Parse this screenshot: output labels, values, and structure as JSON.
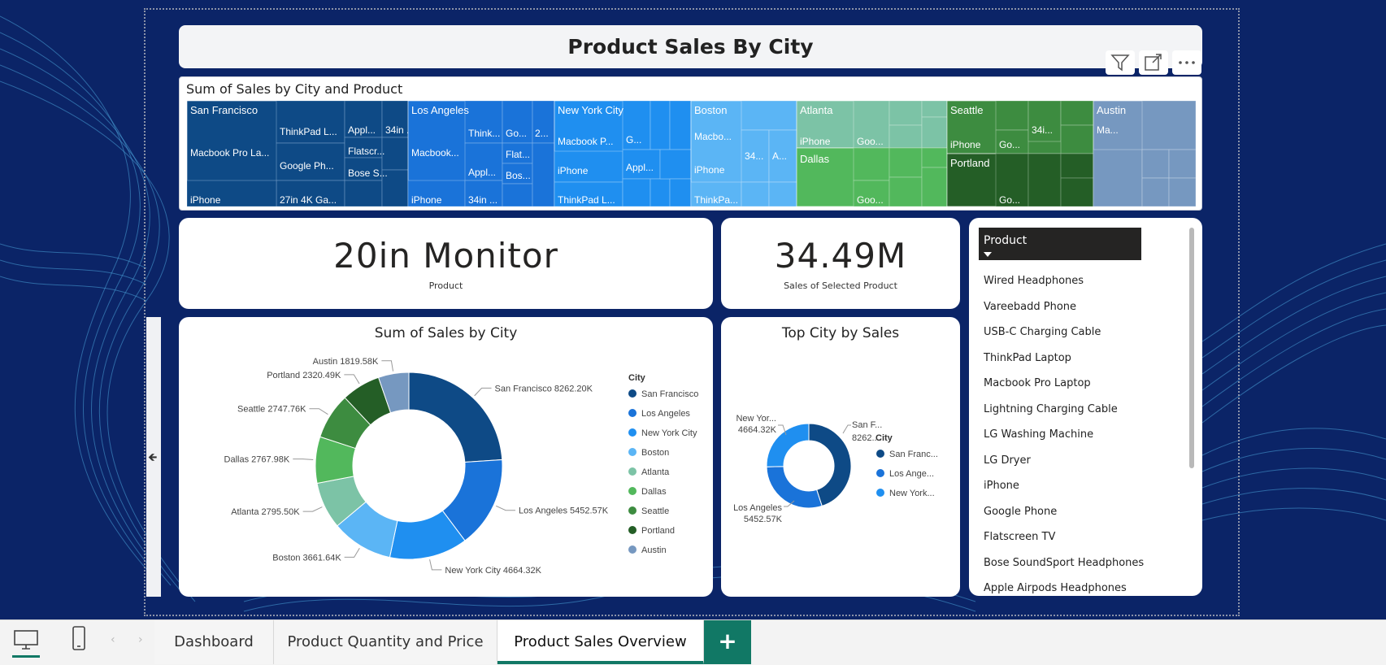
{
  "header": {
    "title": "Product Sales By City"
  },
  "visual_actions": [
    "filter-icon",
    "focus-mode-icon",
    "more-options-icon"
  ],
  "treemap": {
    "title": "Sum of Sales by City and Product",
    "cities": [
      {
        "name": "San Francisco",
        "color": "#0e4a86",
        "labels": [
          "ThinkPad L...",
          "Appl...",
          "34in ...",
          "Macbook Pro La...",
          "Google Ph...",
          "Flatscr...",
          "Bose S...",
          "iPhone",
          "27in 4K Ga..."
        ]
      },
      {
        "name": "Los Angeles",
        "color": "#1a73d9",
        "labels": [
          "Think...",
          "Go...",
          "2...",
          "Macbook...",
          "Flat...",
          "Appl...",
          "Bos...",
          "iPhone",
          "34in ..."
        ]
      },
      {
        "name": "New York City",
        "color": "#1f8ff0",
        "labels": [
          "Macbook P...",
          "G...",
          "iPhone",
          "Appl...",
          "ThinkPad L..."
        ]
      },
      {
        "name": "Boston",
        "color": "#5bb5f5",
        "labels": [
          "Macbo...",
          "iPhone",
          "34...",
          "A...",
          "ThinkPa..."
        ]
      },
      {
        "name": "Atlanta",
        "color": "#7cc3a6",
        "labels": [
          "iPhone",
          "Goo..."
        ]
      },
      {
        "name": "Dallas",
        "color": "#52b85c",
        "labels": [
          "Goo..."
        ]
      },
      {
        "name": "Seattle",
        "color": "#3d8c40",
        "labels": [
          "iPhone",
          "Go...",
          "34i..."
        ]
      },
      {
        "name": "Portland",
        "color": "#245e26",
        "labels": [
          "Go..."
        ]
      },
      {
        "name": "Austin",
        "color": "#7698c0",
        "labels": [
          "Ma..."
        ]
      }
    ]
  },
  "kpi_product": {
    "value": "20in Monitor",
    "label": "Product"
  },
  "kpi_sales": {
    "value": "34.49M",
    "label": "Sales of Selected Product"
  },
  "donut1": {
    "title": "Sum of Sales by City",
    "legend_title": "City"
  },
  "donut2": {
    "title": "Top City by Sales",
    "legend_title": "City",
    "legend": [
      "San Franc...",
      "Los Ange...",
      "New York..."
    ],
    "labels": [
      "San F...",
      "8262....",
      "New Yor...",
      "4664.32K",
      "Los Angeles",
      "5452.57K"
    ]
  },
  "chart_data": [
    {
      "type": "pie",
      "title": "Sum of Sales by City",
      "legend_title": "City",
      "categories": [
        "San Francisco",
        "Los Angeles",
        "New York City",
        "Boston",
        "Atlanta",
        "Dallas",
        "Seattle",
        "Portland",
        "Austin"
      ],
      "values": [
        8262.2,
        5452.57,
        4664.32,
        3661.64,
        2795.5,
        2767.98,
        2747.76,
        2320.49,
        1819.58
      ],
      "data_labels": [
        "San Francisco 8262.20K",
        "Los Angeles 5452.57K",
        "New York City 4664.32K",
        "Boston 3661.64K",
        "Atlanta 2795.50K",
        "Dallas 2767.98K",
        "Seattle 2747.76K",
        "Portland 2320.49K",
        "Austin 1819.58K"
      ],
      "colors": [
        "#0e4a86",
        "#1a73d9",
        "#1f8ff0",
        "#5bb5f5",
        "#7cc3a6",
        "#52b85c",
        "#3d8c40",
        "#245e26",
        "#7698c0"
      ],
      "legend_position": "right"
    },
    {
      "type": "pie",
      "title": "Top City by Sales",
      "legend_title": "City",
      "categories": [
        "San Francisco",
        "Los Angeles",
        "New York City"
      ],
      "values": [
        8262.2,
        5452.57,
        4664.32
      ],
      "colors": [
        "#0e4a86",
        "#1a73d9",
        "#1f8ff0"
      ],
      "legend_position": "right"
    }
  ],
  "slicer": {
    "header": "Product",
    "items": [
      "Wired Headphones",
      "Vareebadd Phone",
      "USB-C Charging Cable",
      "ThinkPad Laptop",
      "Macbook Pro Laptop",
      "Lightning Charging Cable",
      "LG Washing Machine",
      "LG Dryer",
      "iPhone",
      "Google Phone",
      "Flatscreen TV",
      "Bose SoundSport Headphones",
      "Apple Airpods Headphones"
    ]
  },
  "tabs": [
    {
      "label": "Dashboard",
      "active": false
    },
    {
      "label": "Product Quantity and Price",
      "active": false
    },
    {
      "label": "Product Sales Overview",
      "active": true
    }
  ],
  "tab_add_label": "+"
}
